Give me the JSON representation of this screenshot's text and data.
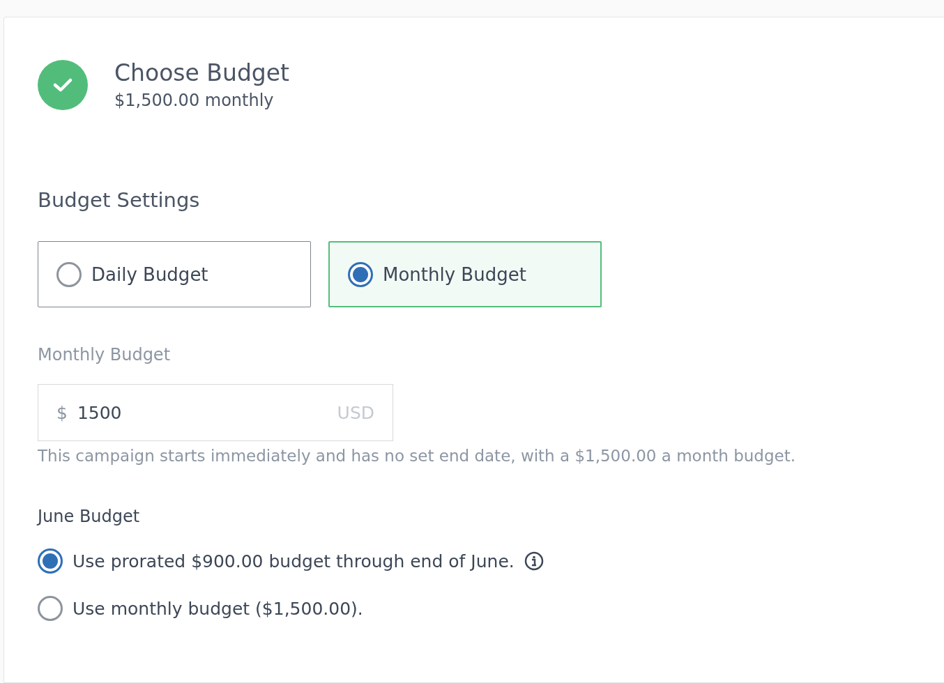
{
  "header": {
    "title": "Choose Budget",
    "subtitle": "$1,500.00 monthly",
    "complete": true
  },
  "section_title": "Budget Settings",
  "budget_types": [
    {
      "label": "Daily Budget",
      "selected": false
    },
    {
      "label": "Monthly Budget",
      "selected": true
    }
  ],
  "amount_field": {
    "label": "Monthly Budget",
    "prefix": "$",
    "value": "1500",
    "suffix": "USD"
  },
  "helper_text": "This campaign starts immediately and has no set end date, with a $1,500.00 a month budget.",
  "june": {
    "title": "June Budget",
    "options": [
      {
        "label": "Use prorated $900.00 budget through end of June.",
        "selected": true,
        "info": true
      },
      {
        "label": "Use monthly budget ($1,500.00).",
        "selected": false,
        "info": false
      }
    ]
  }
}
